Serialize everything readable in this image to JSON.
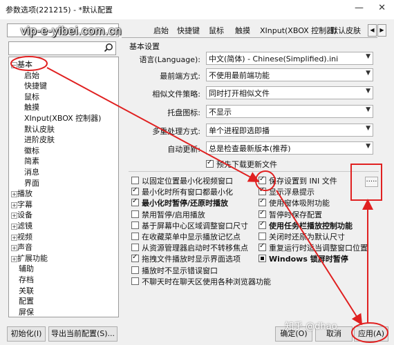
{
  "window": {
    "title": "参数选项(221215) - *默认配置",
    "minimize_glyph": "—",
    "close_glyph": "✕"
  },
  "watermark": "vip-e-yibei.com.cn",
  "tabs": [
    "启始",
    "快捷键",
    "鼠标",
    "触摸",
    "XInput(XBOX 控制器)",
    "默认皮肤"
  ],
  "tab_arrows": [
    "◀",
    "▶"
  ],
  "tree": [
    {
      "label": "基本",
      "expander": "−"
    },
    {
      "label": "启始",
      "expander": ""
    },
    {
      "label": "快捷键",
      "expander": ""
    },
    {
      "label": "鼠标",
      "expander": ""
    },
    {
      "label": "触摸",
      "expander": ""
    },
    {
      "label": "XInput(XBOX 控制器)",
      "expander": ""
    },
    {
      "label": "默认皮肤",
      "expander": ""
    },
    {
      "label": "进阶皮肤",
      "expander": ""
    },
    {
      "label": "徽标",
      "expander": ""
    },
    {
      "label": "简素",
      "expander": ""
    },
    {
      "label": "消息",
      "expander": ""
    },
    {
      "label": "界面",
      "expander": ""
    },
    {
      "label": "播放",
      "expander": "+"
    },
    {
      "label": "字幕",
      "expander": "+"
    },
    {
      "label": "设备",
      "expander": "+"
    },
    {
      "label": "滤镜",
      "expander": "+"
    },
    {
      "label": "视频",
      "expander": "+"
    },
    {
      "label": "声音",
      "expander": "+"
    },
    {
      "label": "扩展功能",
      "expander": "+"
    },
    {
      "label": "辅助",
      "expander": ""
    },
    {
      "label": "存档",
      "expander": ""
    },
    {
      "label": "关联",
      "expander": ""
    },
    {
      "label": "配置",
      "expander": ""
    },
    {
      "label": "屏保",
      "expander": ""
    }
  ],
  "basic": {
    "group_title": "基本设置",
    "rows": [
      {
        "label": "语言(Language):",
        "value": "中文(简体) - Chinese(Simplified).ini"
      },
      {
        "label": "最前端方式:",
        "value": "不使用最前端功能"
      },
      {
        "label": "相似文件策略:",
        "value": "同时打开相似文件"
      },
      {
        "label": "托盘图标:",
        "value": "不显示"
      },
      {
        "label": "多重处理方式:",
        "value": "单个进程即选即播"
      },
      {
        "label": "自动更新:",
        "value": "总是检查最新版本(推荐)"
      }
    ],
    "combo_arrow": "▼",
    "predownload": "预先下载更新文件",
    "ellipsis": "....."
  },
  "checks_left": [
    {
      "label": "以固定位置最小化视频窗口",
      "state": "off",
      "bold": false
    },
    {
      "label": "最小化时所有窗口都最小化",
      "state": "on",
      "bold": false
    },
    {
      "label": "最小化时暂停/还原时播放",
      "state": "on",
      "bold": true
    },
    {
      "label": "禁用暂停/启用播放",
      "state": "off",
      "bold": false
    },
    {
      "label": "基于屏幕中心区域调整窗口尺寸",
      "state": "off",
      "bold": false
    },
    {
      "label": "在收藏菜单中显示播放记忆点",
      "state": "off",
      "bold": false
    },
    {
      "label": "从资源管理器启动时不转移焦点",
      "state": "off",
      "bold": false
    },
    {
      "label": "拖拽文件播放时显示界面选项",
      "state": "on",
      "bold": false
    },
    {
      "label": "播放时不显示错误窗口",
      "state": "off",
      "bold": false
    },
    {
      "label": "不聊天时在聊天区使用各种浏览器功能",
      "state": "off",
      "bold": false
    }
  ],
  "checks_right": [
    {
      "label": "保存设置到 INI 文件",
      "state": "on",
      "bold": false
    },
    {
      "label": "显示浮悬提示",
      "state": "on",
      "bold": false
    },
    {
      "label": "使用窗体吸附功能",
      "state": "on",
      "bold": false
    },
    {
      "label": "暂停时保存配置",
      "state": "on",
      "bold": false
    },
    {
      "label": "使用任务栏播放控制功能",
      "state": "on",
      "bold": true
    },
    {
      "label": "关闭时还原为默认尺寸",
      "state": "off",
      "bold": false
    },
    {
      "label": "重复运行时适当调整窗口位置",
      "state": "on",
      "bold": false
    },
    {
      "label": "Windows 锁屏时暂停",
      "state": "sq",
      "bold": true
    }
  ],
  "buttons": {
    "init": "初始化(I)",
    "export": "导出当前配置(S)...",
    "ok": "确定(O)",
    "cancel": "取消",
    "apply": "应用(A)"
  },
  "footer_watermark": "知乎 @dhao",
  "annotation_color": "#e02020"
}
